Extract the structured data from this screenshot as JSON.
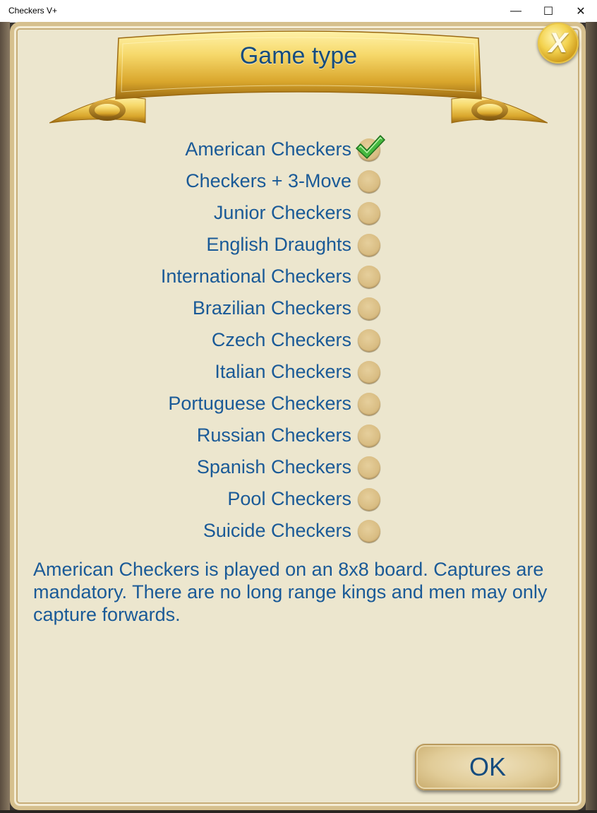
{
  "window": {
    "title": "Checkers V+",
    "minimize_glyph": "—",
    "maximize_glyph": "☐",
    "close_glyph": "✕"
  },
  "dialog": {
    "title": "Game type",
    "close_label": "X",
    "selected_type": "American Checkers",
    "game_types": [
      {
        "label": "American Checkers",
        "selected": true
      },
      {
        "label": "Checkers + 3-Move",
        "selected": false
      },
      {
        "label": "Junior Checkers",
        "selected": false
      },
      {
        "label": "English Draughts",
        "selected": false
      },
      {
        "label": "International Checkers",
        "selected": false
      },
      {
        "label": "Brazilian Checkers",
        "selected": false
      },
      {
        "label": "Czech Checkers",
        "selected": false
      },
      {
        "label": "Italian Checkers",
        "selected": false
      },
      {
        "label": "Portuguese Checkers",
        "selected": false
      },
      {
        "label": "Russian Checkers",
        "selected": false
      },
      {
        "label": "Spanish Checkers",
        "selected": false
      },
      {
        "label": "Pool Checkers",
        "selected": false
      },
      {
        "label": "Suicide Checkers",
        "selected": false
      }
    ],
    "description": "American Checkers is played on an 8x8 board. Captures are mandatory. There are no long range kings and men may only capture forwards.",
    "ok_label": "OK"
  },
  "colors": {
    "text": "#1a5a97",
    "title": "#164c7e",
    "background": "#ece6ce",
    "gold": "#e8c548",
    "check": "#3fae3a"
  },
  "icons": {
    "close": "close-icon",
    "selected": "checkmark-icon",
    "unselected": "radio-circle-icon"
  }
}
